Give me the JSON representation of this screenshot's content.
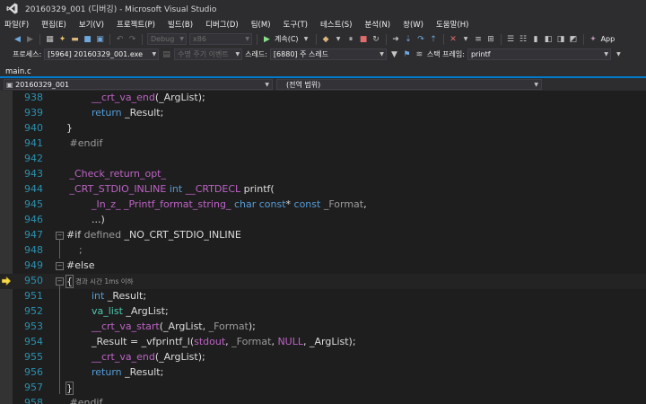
{
  "window": {
    "title": "20160329_001 (디버깅) - Microsoft Visual Studio"
  },
  "menu": [
    "파일(F)",
    "편집(E)",
    "보기(V)",
    "프로젝트(P)",
    "빌드(B)",
    "디버그(D)",
    "팀(M)",
    "도구(T)",
    "테스트(S)",
    "분석(N)",
    "창(W)",
    "도움말(H)"
  ],
  "toolbar": {
    "config": "Debug",
    "platform": "x86",
    "continue_label": "계속(C)",
    "app_label": "App"
  },
  "debug_location": {
    "process_label": "프로세스:",
    "process_value": "[5964] 20160329_001.exe",
    "lifecycle_label": "수명 주기 이벤트",
    "thread_label": "스레드:",
    "thread_value": "[6880] 주 스레드",
    "stackframe_label": "스택 프레임:",
    "stackframe_value": "printf"
  },
  "file_tab": "main.c",
  "nav": {
    "project": "20160329_001",
    "scope": "(전역 범위)"
  },
  "code": {
    "current_line": "950",
    "perf_hint": "경과 시간 1ms 이하",
    "lines": [
      {
        "num": "938",
        "text": "        __crt_va_end(_ArgList);"
      },
      {
        "num": "939",
        "text": "        return _Result;"
      },
      {
        "num": "940",
        "text": "    }"
      },
      {
        "num": "941",
        "text": " #endif"
      },
      {
        "num": "942",
        "text": ""
      },
      {
        "num": "943",
        "text": " _Check_return_opt_"
      },
      {
        "num": "944",
        "text": " _CRT_STDIO_INLINE int __CRTDECL printf("
      },
      {
        "num": "945",
        "text": "        _In_z_ _Printf_format_string_ char const* const _Format,"
      },
      {
        "num": "946",
        "text": "        ...)"
      },
      {
        "num": "947",
        "text": "#if defined _NO_CRT_STDIO_INLINE"
      },
      {
        "num": "948",
        "text": "    ;"
      },
      {
        "num": "949",
        "text": "#else"
      },
      {
        "num": "950",
        "text": "{"
      },
      {
        "num": "951",
        "text": "        int _Result;"
      },
      {
        "num": "952",
        "text": "        va_list _ArgList;"
      },
      {
        "num": "953",
        "text": "        __crt_va_start(_ArgList, _Format);"
      },
      {
        "num": "954",
        "text": "        _Result = _vfprintf_l(stdout, _Format, NULL, _ArgList);"
      },
      {
        "num": "955",
        "text": "        __crt_va_end(_ArgList);"
      },
      {
        "num": "956",
        "text": "        return _Result;"
      },
      {
        "num": "957",
        "text": "    }"
      },
      {
        "num": "958",
        "text": " #endif"
      }
    ]
  },
  "colors": {
    "accent": "#007acc",
    "line_number": "#2b91af",
    "keyword": "#569cd6",
    "macro": "#bd63c5",
    "type": "#4ec9b0",
    "continue_green": "#8ae28a"
  }
}
